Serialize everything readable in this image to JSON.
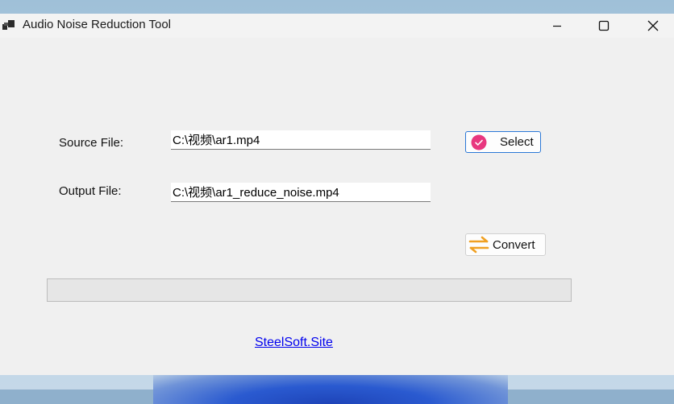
{
  "window": {
    "title": "Audio Noise Reduction Tool",
    "controls": {
      "minimize": "minimize-icon",
      "maximize": "maximize-icon",
      "close": "close-icon"
    }
  },
  "form": {
    "source_label": "Source File:",
    "source_value": "C:\\视频\\ar1.mp4",
    "output_label": "Output File:",
    "output_value": "C:\\视频\\ar1_reduce_noise.mp4"
  },
  "buttons": {
    "select_label": "Select",
    "select_icon": "check-circle-icon",
    "convert_label": "Convert",
    "convert_icon": "swap-arrows-icon"
  },
  "progress": {
    "value": 0
  },
  "footer": {
    "link_text": "SteelSoft.Site"
  },
  "colors": {
    "accent_pink": "#e8377f",
    "convert_orange": "#f0a022",
    "link_blue": "#0000ee",
    "focus_border": "#2b78d6"
  }
}
